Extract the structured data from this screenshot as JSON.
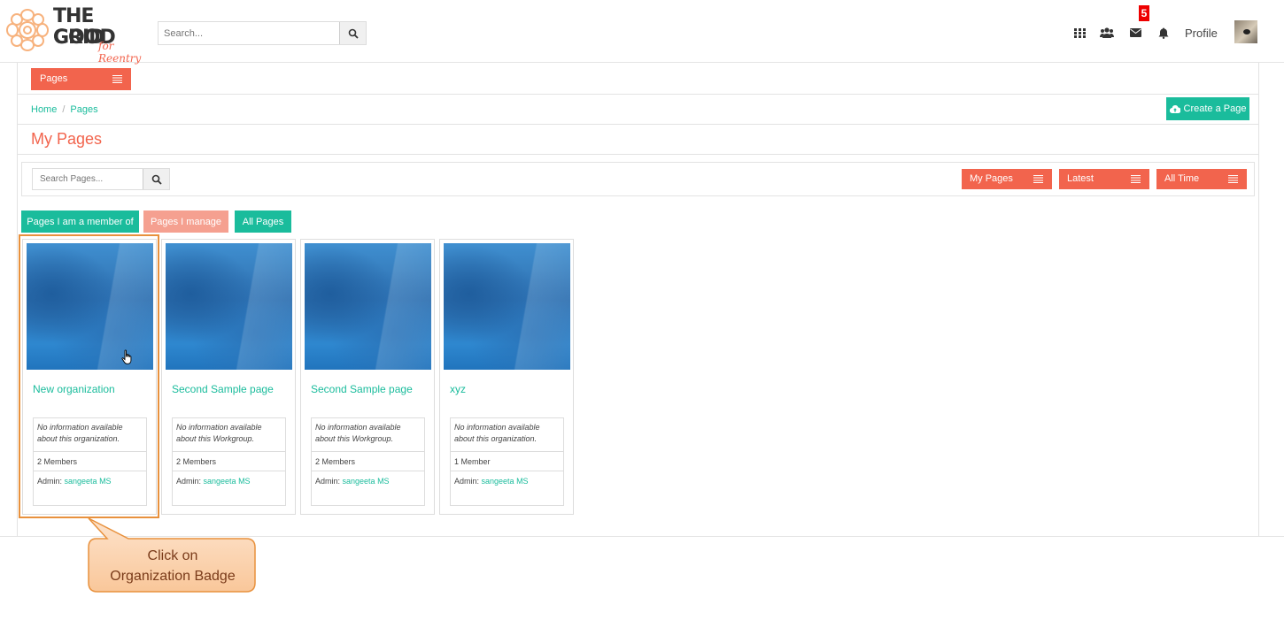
{
  "header": {
    "logo": {
      "line1": "THE GOOD",
      "line2": "GRID",
      "tagline": "for Reentry"
    },
    "search_placeholder": "Search...",
    "icons": [
      "grid-icon",
      "users-icon",
      "envelope-icon",
      "bell-icon"
    ],
    "message_count": "5",
    "profile_label": "Profile"
  },
  "pages_menu_label": "Pages",
  "breadcrumb": {
    "home": "Home",
    "separator": "/",
    "current": "Pages"
  },
  "create_button_label": "Create a Page",
  "page_title": "My Pages",
  "filters": {
    "search_placeholder": "Search Pages...",
    "dropdowns": [
      "My Pages",
      "Latest",
      "All Time"
    ]
  },
  "tabs": [
    {
      "label": "Pages I am a member of",
      "color": "#1abc9c"
    },
    {
      "label": "Pages I manage",
      "color": "#f5a090"
    },
    {
      "label": "All Pages",
      "color": "#1abc9c"
    }
  ],
  "cards": [
    {
      "name": "New organization",
      "description": "No information available about this organization.",
      "members": "2 Members",
      "admin_label": "Admin:",
      "admin_name": "sangeeta MS"
    },
    {
      "name": "Second Sample page",
      "description": "No information available about this Workgroup.",
      "members": "2 Members",
      "admin_label": "Admin:",
      "admin_name": "sangeeta MS"
    },
    {
      "name": "Second Sample page",
      "description": "No information available about this Workgroup.",
      "members": "2 Members",
      "admin_label": "Admin:",
      "admin_name": "sangeeta MS"
    },
    {
      "name": "xyz",
      "description": "No information available about this organization.",
      "members": "1 Member",
      "admin_label": "Admin:",
      "admin_name": "sangeeta MS"
    }
  ],
  "callout": {
    "line1": "Click on",
    "line2": "Organization Badge"
  },
  "colors": {
    "accent": "#f2644d",
    "teal": "#1abc9c",
    "highlight": "#e8913d"
  }
}
